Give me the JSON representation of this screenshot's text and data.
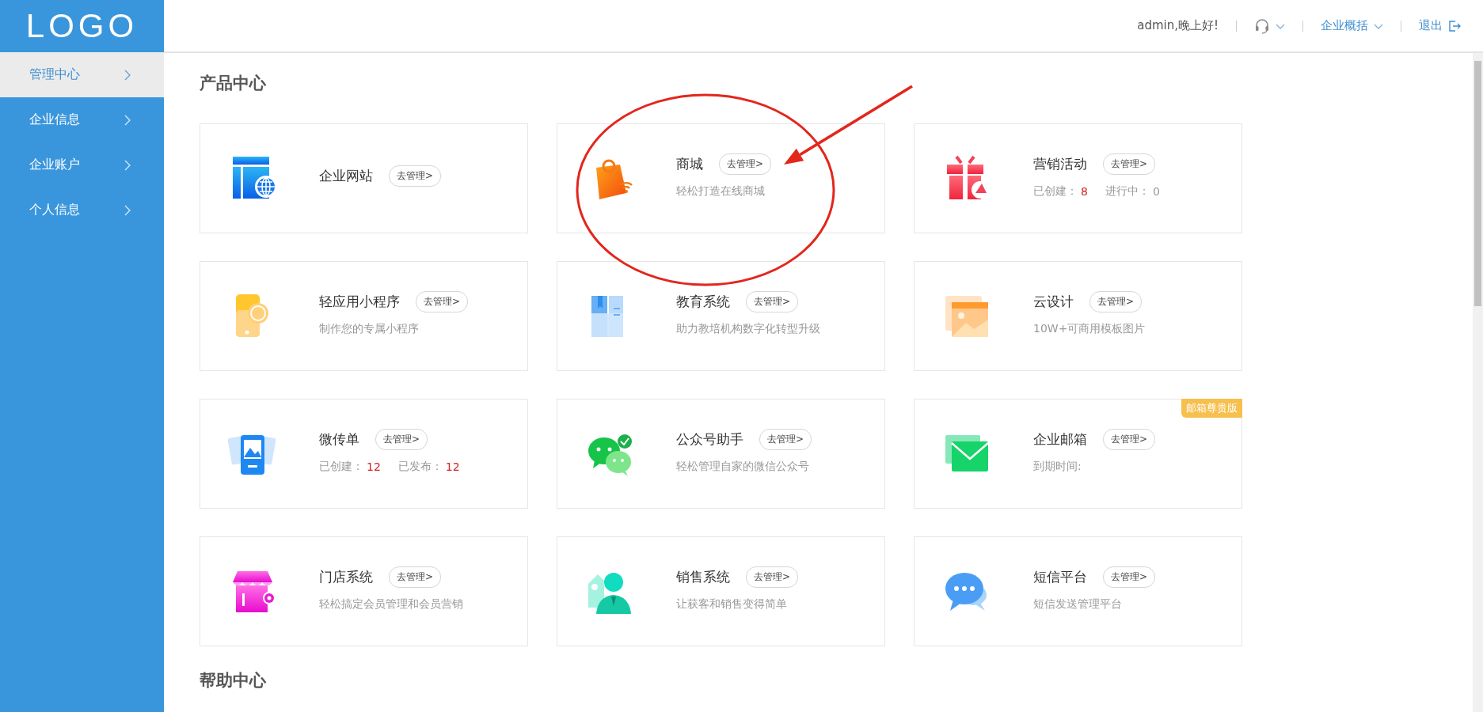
{
  "logo": "LOGO",
  "header": {
    "greeting": "admin,晚上好!",
    "menu": "企业概括",
    "logout": "退出"
  },
  "sidebar": {
    "items": [
      {
        "label": "管理中心",
        "selected": true
      },
      {
        "label": "企业信息",
        "selected": false
      },
      {
        "label": "企业账户",
        "selected": false
      },
      {
        "label": "个人信息",
        "selected": false
      }
    ]
  },
  "product_center": {
    "title": "产品中心",
    "cards": [
      {
        "name": "企业网站",
        "action": "去管理>"
      },
      {
        "name": "商城",
        "action": "去管理>",
        "desc": "轻松打造在线商城"
      },
      {
        "name": "营销活动",
        "action": "去管理>",
        "stats": [
          {
            "label": "已创建：",
            "value": "8",
            "highlight": true
          },
          {
            "label": "进行中：",
            "value": "0",
            "highlight": false
          }
        ]
      },
      {
        "name": "轻应用小程序",
        "action": "去管理>",
        "desc": "制作您的专属小程序"
      },
      {
        "name": "教育系统",
        "action": "去管理>",
        "desc": "助力教培机构数字化转型升级"
      },
      {
        "name": "云设计",
        "action": "去管理>",
        "desc": "10W+可商用模板图片"
      },
      {
        "name": "微传单",
        "action": "去管理>",
        "stats": [
          {
            "label": "已创建：",
            "value": "12",
            "highlight": true
          },
          {
            "label": "已发布：",
            "value": "12",
            "highlight": true
          }
        ]
      },
      {
        "name": "公众号助手",
        "action": "去管理>",
        "desc": "轻松管理自家的微信公众号"
      },
      {
        "name": "企业邮箱",
        "action": "去管理>",
        "desc": "到期时间:",
        "badge": "邮箱尊贵版"
      },
      {
        "name": "门店系统",
        "action": "去管理>",
        "desc": "轻松搞定会员管理和会员营销"
      },
      {
        "name": "销售系统",
        "action": "去管理>",
        "desc": "让获客和销售变得简单"
      },
      {
        "name": "短信平台",
        "action": "去管理>",
        "desc": "短信发送管理平台"
      }
    ]
  },
  "help_center": {
    "title": "帮助中心"
  },
  "annotations": [
    {
      "kind": "ellipse",
      "color": "#e3261c"
    },
    {
      "kind": "arrow",
      "color": "#e3261c"
    }
  ]
}
